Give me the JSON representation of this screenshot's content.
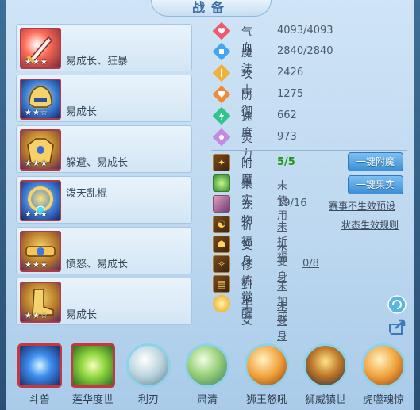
{
  "title": "战备",
  "equipment": [
    {
      "desc": "易成长、狂暴",
      "stars": "★★★",
      "icon": "sword-icon"
    },
    {
      "desc": "易成长",
      "stars": "★★☆",
      "icon": "helmet-icon"
    },
    {
      "desc": "躲避、易成长",
      "stars": "★★★",
      "icon": "armor-icon"
    },
    {
      "desc": "泼天乱棍",
      "stars": "★★★",
      "icon": "necklace-icon"
    },
    {
      "desc": "愤怒、易成长",
      "stars": "★★★",
      "icon": "belt-icon"
    },
    {
      "desc": "易成长",
      "stars": "★★☆",
      "icon": "boots-icon"
    }
  ],
  "stats": [
    {
      "label": "气血",
      "value": "4093/4093",
      "icon": "heart-icon",
      "color": "#ef5a6a"
    },
    {
      "label": "魔法",
      "value": "2840/2840",
      "icon": "mana-icon",
      "color": "#44a6f0"
    },
    {
      "label": "攻击",
      "value": "2426",
      "icon": "attack-icon",
      "color": "#f0b23a"
    },
    {
      "label": "防御",
      "value": "1275",
      "icon": "defense-icon",
      "color": "#f08a3a"
    },
    {
      "label": "速度",
      "value": "662",
      "icon": "speed-icon",
      "color": "#2ec48a"
    },
    {
      "label": "灵力",
      "value": "973",
      "icon": "spirit-icon",
      "color": "#c48ae0"
    }
  ],
  "extras": {
    "enchant": {
      "label": "附魔",
      "value": "5/5"
    },
    "fruit": {
      "label": "果实",
      "value": "未使用"
    },
    "pet": {
      "label": "宠物",
      "value": "19/16"
    },
    "bless": {
      "label": "祈福",
      "value": "未祈福"
    },
    "transform": {
      "label": "变身",
      "value": "未变身"
    },
    "awaken": {
      "label": "修炼觉醒",
      "value": "0/8"
    },
    "seal": {
      "label": "封地",
      "value": "未加成"
    },
    "child": {
      "label": "子女",
      "value": "未变身"
    }
  },
  "buttons": {
    "enchant_all": "一键附魔",
    "fruit_all": "一键果实"
  },
  "links": {
    "preset": "赛事不生效预设",
    "rules": "状态生效规则"
  },
  "skills": [
    {
      "name": "斗兽",
      "underline": true
    },
    {
      "name": "莲华度世",
      "underline": true
    },
    {
      "name": "利刃",
      "underline": false
    },
    {
      "name": "肃清",
      "underline": false
    },
    {
      "name": "狮王怒吼",
      "underline": false
    },
    {
      "name": "狮威镇世",
      "underline": false
    },
    {
      "name": "虎噬魂惊",
      "underline": true
    }
  ]
}
